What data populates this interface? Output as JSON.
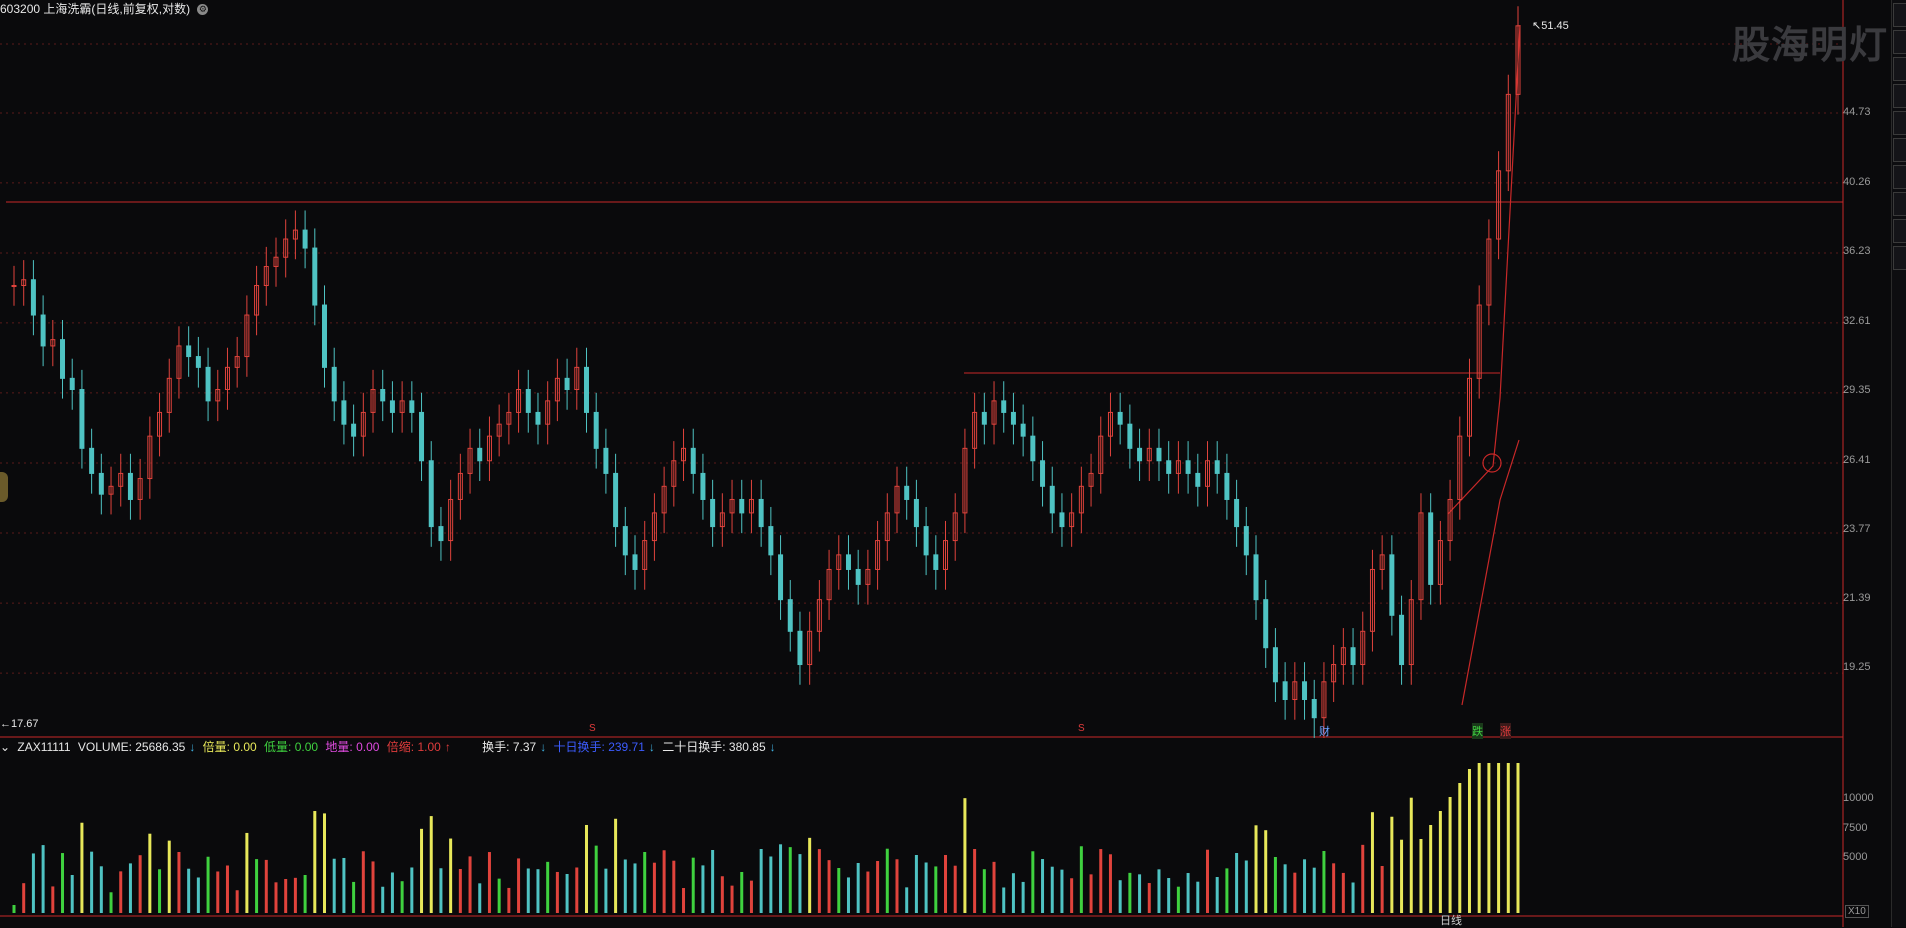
{
  "header": {
    "code": "603200",
    "name": "上海洗霸",
    "mode": "(日线,前复权,对数)"
  },
  "watermark": "股海明灯",
  "price_axis": {
    "labels": [
      "44.73",
      "40.26",
      "36.23",
      "32.61",
      "29.35",
      "26.41",
      "23.77",
      "21.39",
      "19.25"
    ],
    "high_label": "51.45",
    "low_label": "←17.67"
  },
  "markers": {
    "s1": "S",
    "s2": "S",
    "cai": "财",
    "die": "跌",
    "zhang": "涨"
  },
  "volume_legend": {
    "name": "ZAX11111",
    "volume": "VOLUME: 25686.35",
    "beiliang": "倍量: 0.00",
    "diliang": "低量: 0.00",
    "diliang2": "地量: 0.00",
    "beisuo": "倍缩: 1.00",
    "huanshou": "换手: 7.37",
    "shiri": "十日换手: 239.71",
    "ershiri": "二十日换手: 380.85"
  },
  "volume_axis": {
    "labels": [
      "10000",
      "7500",
      "5000"
    ],
    "unit": "X10"
  },
  "bottom_tab": "日线",
  "colors": {
    "up": "#e0433c",
    "down": "#4fc3c3",
    "grid": "#5a1a1a",
    "level_line": "#c82828",
    "vol_yellow": "#e8e85a",
    "vol_green": "#3fd13f"
  },
  "chart_data": {
    "type": "candlestick",
    "scale": "log",
    "ylim": [
      17.67,
      51.45
    ],
    "series_close": [
      34.5,
      34.8,
      33.0,
      31.5,
      31.8,
      30.0,
      29.5,
      27.0,
      26.0,
      25.2,
      25.5,
      26.0,
      25.0,
      25.8,
      27.5,
      28.5,
      30.0,
      31.5,
      31.0,
      30.5,
      29.0,
      29.5,
      30.5,
      31.0,
      33.0,
      34.5,
      35.5,
      36.0,
      37.0,
      37.5,
      36.5,
      33.5,
      30.5,
      29.0,
      28.0,
      27.5,
      28.5,
      29.5,
      29.0,
      28.5,
      29.0,
      28.5,
      26.5,
      24.0,
      23.5,
      25.0,
      26.0,
      27.0,
      26.5,
      27.5,
      28.0,
      28.5,
      29.5,
      28.5,
      28.0,
      29.0,
      30.0,
      29.5,
      30.5,
      28.5,
      27.0,
      26.0,
      24.0,
      23.0,
      22.5,
      23.5,
      24.5,
      25.5,
      26.5,
      27.0,
      26.0,
      25.0,
      24.0,
      24.5,
      25.0,
      24.5,
      25.0,
      24.0,
      23.0,
      21.5,
      20.5,
      19.5,
      20.5,
      21.5,
      22.5,
      23.0,
      22.5,
      22.0,
      22.5,
      23.5,
      24.5,
      25.5,
      25.0,
      24.0,
      23.0,
      22.5,
      23.5,
      24.5,
      27.0,
      28.5,
      28.0,
      29.0,
      28.5,
      28.0,
      27.5,
      26.5,
      25.5,
      24.5,
      24.0,
      24.5,
      25.5,
      26.0,
      27.5,
      28.5,
      28.0,
      27.0,
      26.5,
      27.0,
      26.5,
      26.0,
      26.5,
      26.0,
      25.5,
      26.5,
      26.0,
      25.0,
      24.0,
      23.0,
      21.5,
      20.0,
      19.0,
      18.5,
      19.0,
      18.5,
      18.0,
      19.0,
      19.5,
      20.0,
      19.5,
      20.5,
      22.5,
      23.0,
      21.0,
      19.5,
      21.5,
      24.5,
      22.0,
      23.5,
      25.0,
      27.5,
      30.0,
      33.5,
      37.0,
      41.0,
      46.0,
      51.0
    ]
  }
}
